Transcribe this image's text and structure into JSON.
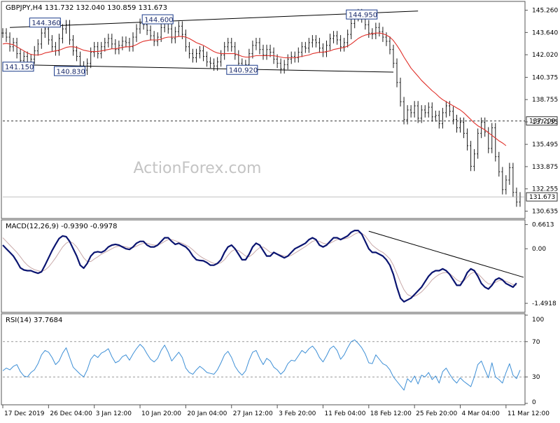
{
  "header": {
    "symbol": "GBPJPY,H4",
    "ohlc": "131.732 132.040 130.859 131.673"
  },
  "watermark": "ActionForex.com",
  "colors": {
    "price": "#1a1a1a",
    "ema": "#e0302a",
    "macd": "#0a1470",
    "signal": "#c8a8a8",
    "rsi": "#3d8fd6",
    "trendline": "#000000",
    "label_border": "#1a3a8a",
    "grid": "#888888"
  },
  "chart_data": [
    {
      "type": "line",
      "title": "GBPJPY,H4",
      "subtitle": "131.732 132.040 130.859 131.673",
      "ylim": [
        130.2,
        145.8
      ],
      "y_ticks": [
        "145.260",
        "143.640",
        "142.020",
        "140.375",
        "138.755",
        "137.135",
        "135.495",
        "133.875",
        "132.255",
        "130.635"
      ],
      "y_tick_values": [
        145.26,
        143.64,
        142.02,
        140.375,
        138.755,
        137.135,
        135.495,
        133.875,
        132.255,
        130.635
      ],
      "x_ticks": [
        "17 Dec 2019",
        "26 Dec 04:00",
        "3 Jan 12:00",
        "10 Jan 20:00",
        "20 Jan 04:00",
        "27 Jan 12:00",
        "3 Feb 20:00",
        "11 Feb 04:00",
        "18 Feb 12:00",
        "25 Feb 20:00",
        "4 Mar 04:00",
        "11 Mar 12:00"
      ],
      "x_tick_pos": [
        0,
        13,
        26,
        39,
        52,
        65,
        78,
        91,
        104,
        117,
        130,
        143
      ],
      "x_range": [
        0,
        148
      ],
      "series": [
        {
          "name": "GBPJPY,H4",
          "values": [
            143.6,
            143.3,
            142.6,
            142.9,
            142.1,
            141.6,
            141.9,
            141.3,
            141.7,
            142.3,
            142.8,
            143.6,
            143.9,
            143.1,
            142.6,
            142.3,
            143.2,
            143.9,
            144.2,
            143.1,
            142.3,
            141.9,
            141.2,
            140.9,
            141.4,
            142.2,
            142.6,
            142.1,
            142.6,
            142.9,
            143.2,
            142.8,
            142.4,
            142.7,
            143.0,
            142.9,
            142.6,
            143.3,
            143.9,
            144.3,
            144.2,
            143.8,
            143.4,
            143.0,
            143.3,
            144.0,
            144.4,
            143.9,
            143.2,
            143.7,
            144.1,
            143.5,
            142.6,
            142.1,
            141.8,
            142.1,
            142.3,
            141.9,
            141.5,
            141.4,
            141.2,
            141.5,
            142.0,
            142.6,
            142.9,
            142.6,
            142.0,
            141.4,
            141.0,
            141.3,
            142.1,
            142.7,
            142.9,
            142.4,
            142.0,
            142.4,
            142.2,
            141.7,
            141.4,
            141.0,
            141.3,
            141.7,
            141.9,
            141.8,
            142.2,
            142.6,
            142.5,
            142.9,
            143.1,
            142.9,
            142.5,
            142.2,
            142.7,
            143.2,
            143.4,
            143.1,
            142.6,
            142.9,
            143.5,
            144.3,
            144.8,
            145.0,
            144.7,
            144.2,
            143.6,
            143.5,
            144.0,
            143.7,
            143.3,
            143.0,
            142.4,
            141.4,
            140.0,
            138.6,
            137.3,
            138.0,
            137.8,
            138.3,
            137.4,
            138.0,
            137.8,
            138.2,
            137.5,
            137.6,
            137.0,
            137.8,
            138.3,
            137.9,
            137.3,
            136.7,
            137.1,
            136.3,
            135.4,
            133.9,
            134.8,
            136.3,
            137.1,
            136.4,
            135.2,
            136.7,
            134.6,
            133.5,
            132.2,
            132.9,
            133.8,
            132.0,
            131.3,
            131.67
          ]
        },
        {
          "name": "EMA",
          "values": [
            142.8,
            142.85,
            142.8,
            142.75,
            142.6,
            142.45,
            142.3,
            142.15,
            142.05,
            142.0,
            142.0,
            142.05,
            142.15,
            142.2,
            142.25,
            142.3,
            142.35,
            142.45,
            142.55,
            142.6,
            142.6,
            142.55,
            142.45,
            142.35,
            142.3,
            142.25,
            142.25,
            142.25,
            142.3,
            142.35,
            142.4,
            142.45,
            142.45,
            142.5,
            142.55,
            142.6,
            142.6,
            142.65,
            142.75,
            142.9,
            143.0,
            143.05,
            143.1,
            143.1,
            143.1,
            143.15,
            143.25,
            143.3,
            143.3,
            143.3,
            143.35,
            143.35,
            143.3,
            143.2,
            143.05,
            142.9,
            142.8,
            142.7,
            142.55,
            142.4,
            142.25,
            142.15,
            142.1,
            142.1,
            142.1,
            142.1,
            142.1,
            142.0,
            141.9,
            141.85,
            141.85,
            141.9,
            141.95,
            141.95,
            141.95,
            141.95,
            141.95,
            141.95,
            141.9,
            141.85,
            141.8,
            141.8,
            141.8,
            141.8,
            141.85,
            141.9,
            141.95,
            142.0,
            142.1,
            142.15,
            142.2,
            142.2,
            142.25,
            142.3,
            142.4,
            142.45,
            142.5,
            142.55,
            142.65,
            142.8,
            143.0,
            143.2,
            143.35,
            143.45,
            143.5,
            143.55,
            143.6,
            143.6,
            143.55,
            143.45,
            143.3,
            143.05,
            142.7,
            142.3,
            141.85,
            141.45,
            141.05,
            140.75,
            140.45,
            140.15,
            139.9,
            139.65,
            139.4,
            139.2,
            138.95,
            138.75,
            138.6,
            138.45,
            138.3,
            138.15,
            138.0,
            137.8,
            137.55,
            137.3,
            137.05,
            136.85,
            136.7,
            136.55,
            136.35,
            136.15,
            135.95,
            135.75,
            135.6,
            135.4
          ]
        }
      ],
      "annotations": [
        {
          "text": "144.360",
          "x": 12,
          "y": 144.36
        },
        {
          "text": "144.600",
          "x": 44,
          "y": 144.6
        },
        {
          "text": "144.950",
          "x": 102,
          "y": 144.95
        },
        {
          "text": "141.150",
          "x": 0,
          "y": 141.15
        },
        {
          "text": "140.830",
          "x": 19,
          "y": 140.83
        },
        {
          "text": "140.920",
          "x": 68,
          "y": 140.92
        }
      ],
      "trendlines": [
        {
          "x1": 2,
          "y1": 144.0,
          "x2": 118,
          "y2": 145.2
        },
        {
          "x1": 2,
          "y1": 141.3,
          "x2": 111,
          "y2": 140.75
        }
      ],
      "hline": {
        "label": "137.200",
        "value": 137.2
      },
      "last_price_label": "131.673",
      "last_price": 131.673
    },
    {
      "type": "line",
      "title": "MACD(12,26,9) -0.9390 -0.9978",
      "ylim": [
        -1.7,
        0.75
      ],
      "y_ticks": [
        "0.6613",
        "0.00",
        "-1.4918"
      ],
      "y_tick_values": [
        0.6613,
        0.0,
        -1.4918
      ],
      "series": [
        {
          "name": "MACD",
          "values": [
            0.1,
            0.0,
            -0.1,
            -0.2,
            -0.35,
            -0.52,
            -0.58,
            -0.6,
            -0.6,
            -0.64,
            -0.67,
            -0.63,
            -0.45,
            -0.25,
            -0.05,
            0.12,
            0.28,
            0.35,
            0.33,
            0.2,
            0.0,
            -0.2,
            -0.45,
            -0.53,
            -0.4,
            -0.2,
            -0.1,
            -0.08,
            -0.1,
            -0.05,
            0.05,
            0.1,
            0.12,
            0.1,
            0.05,
            0.0,
            -0.02,
            0.05,
            0.15,
            0.2,
            0.2,
            0.1,
            0.05,
            0.05,
            0.1,
            0.2,
            0.3,
            0.3,
            0.2,
            0.12,
            0.15,
            0.1,
            0.05,
            -0.05,
            -0.2,
            -0.3,
            -0.32,
            -0.33,
            -0.38,
            -0.45,
            -0.45,
            -0.4,
            -0.3,
            -0.1,
            0.05,
            0.1,
            0.0,
            -0.15,
            -0.3,
            -0.3,
            -0.15,
            0.05,
            0.15,
            0.1,
            -0.05,
            -0.2,
            -0.2,
            -0.1,
            -0.15,
            -0.2,
            -0.25,
            -0.2,
            -0.1,
            0.0,
            0.05,
            0.1,
            0.15,
            0.25,
            0.3,
            0.25,
            0.1,
            0.05,
            0.1,
            0.2,
            0.3,
            0.3,
            0.25,
            0.3,
            0.35,
            0.45,
            0.5,
            0.5,
            0.4,
            0.2,
            0.0,
            -0.1,
            -0.1,
            -0.15,
            -0.2,
            -0.3,
            -0.45,
            -0.7,
            -1.05,
            -1.35,
            -1.45,
            -1.4,
            -1.35,
            -1.25,
            -1.15,
            -1.05,
            -0.9,
            -0.75,
            -0.65,
            -0.6,
            -0.6,
            -0.55,
            -0.6,
            -0.7,
            -0.85,
            -1.0,
            -1.0,
            -0.85,
            -0.65,
            -0.55,
            -0.6,
            -0.75,
            -0.95,
            -1.05,
            -1.1,
            -1.0,
            -0.85,
            -0.8,
            -0.85,
            -0.95,
            -1.0,
            -1.05,
            -0.94
          ]
        },
        {
          "name": "Signal",
          "values": [
            0.3,
            0.2,
            0.1,
            0.0,
            -0.1,
            -0.22,
            -0.35,
            -0.45,
            -0.52,
            -0.57,
            -0.6,
            -0.62,
            -0.58,
            -0.5,
            -0.38,
            -0.25,
            -0.1,
            0.05,
            0.15,
            0.2,
            0.15,
            0.05,
            -0.1,
            -0.25,
            -0.35,
            -0.35,
            -0.28,
            -0.22,
            -0.15,
            -0.1,
            -0.05,
            0.0,
            0.05,
            0.07,
            0.07,
            0.05,
            0.03,
            0.03,
            0.07,
            0.12,
            0.15,
            0.15,
            0.12,
            0.1,
            0.1,
            0.14,
            0.2,
            0.25,
            0.25,
            0.22,
            0.18,
            0.15,
            0.1,
            0.05,
            -0.03,
            -0.12,
            -0.2,
            -0.26,
            -0.31,
            -0.36,
            -0.4,
            -0.41,
            -0.38,
            -0.3,
            -0.18,
            -0.07,
            -0.02,
            -0.05,
            -0.12,
            -0.2,
            -0.22,
            -0.15,
            -0.05,
            0.03,
            0.05,
            -0.02,
            -0.1,
            -0.12,
            -0.14,
            -0.17,
            -0.2,
            -0.21,
            -0.18,
            -0.12,
            -0.06,
            0.0,
            0.06,
            0.13,
            0.2,
            0.23,
            0.2,
            0.15,
            0.13,
            0.15,
            0.2,
            0.25,
            0.26,
            0.27,
            0.29,
            0.34,
            0.4,
            0.44,
            0.42,
            0.35,
            0.22,
            0.1,
            0.02,
            -0.05,
            -0.1,
            -0.18,
            -0.28,
            -0.45,
            -0.68,
            -0.92,
            -1.12,
            -1.25,
            -1.3,
            -1.3,
            -1.25,
            -1.18,
            -1.08,
            -0.97,
            -0.85,
            -0.77,
            -0.7,
            -0.66,
            -0.65,
            -0.68,
            -0.76,
            -0.85,
            -0.9,
            -0.88,
            -0.78,
            -0.68,
            -0.64,
            -0.68,
            -0.78,
            -0.88,
            -0.96,
            -0.97,
            -0.92,
            -0.87,
            -0.86,
            -0.89,
            -0.93,
            -0.98,
            -1.0
          ]
        }
      ],
      "trendline": {
        "x1": 104,
        "y1": 0.48,
        "x2": 148,
        "y2": -0.78
      }
    },
    {
      "type": "line",
      "title": "RSI(14) 37.7684",
      "ylim": [
        0,
        100
      ],
      "y_ticks": [
        "100",
        "70",
        "30",
        "0"
      ],
      "y_tick_values": [
        100,
        70,
        30,
        0
      ],
      "series": [
        {
          "name": "RSI(14)",
          "values": [
            37,
            40,
            38,
            42,
            44,
            36,
            31,
            30,
            35,
            38,
            45,
            55,
            60,
            58,
            52,
            44,
            48,
            57,
            63,
            52,
            41,
            37,
            33,
            30,
            38,
            50,
            55,
            52,
            57,
            59,
            62,
            53,
            46,
            48,
            53,
            55,
            49,
            56,
            62,
            67,
            63,
            56,
            50,
            47,
            51,
            60,
            66,
            58,
            48,
            53,
            58,
            52,
            40,
            35,
            33,
            38,
            42,
            39,
            35,
            34,
            33,
            38,
            46,
            55,
            59,
            52,
            42,
            36,
            32,
            37,
            49,
            58,
            60,
            51,
            44,
            51,
            48,
            41,
            38,
            33,
            37,
            45,
            49,
            48,
            54,
            60,
            57,
            62,
            65,
            60,
            52,
            47,
            54,
            62,
            65,
            60,
            50,
            55,
            63,
            70,
            72,
            68,
            63,
            56,
            46,
            45,
            55,
            50,
            45,
            43,
            38,
            30,
            25,
            20,
            15,
            28,
            24,
            31,
            22,
            32,
            30,
            35,
            27,
            31,
            23,
            36,
            40,
            33,
            27,
            23,
            29,
            25,
            22,
            19,
            30,
            44,
            48,
            38,
            29,
            46,
            30,
            27,
            23,
            35,
            45,
            32,
            28,
            37.77
          ]
        }
      ],
      "guides": [
        70,
        30
      ]
    }
  ]
}
